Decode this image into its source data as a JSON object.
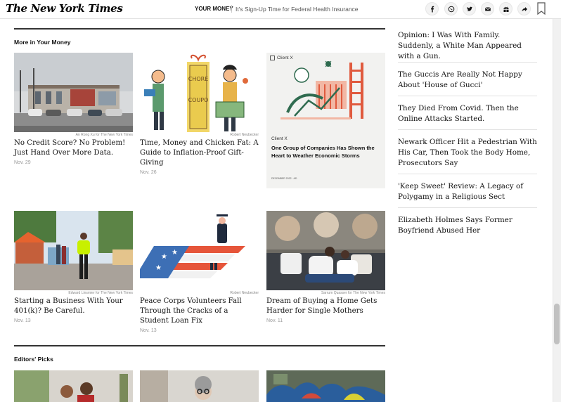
{
  "header": {
    "logo": "The New York Times",
    "section": "YOUR MONEY",
    "headline": "It's Sign-Up Time for Federal Health Insurance",
    "share_icons": [
      "facebook-icon",
      "whatsapp-icon",
      "twitter-icon",
      "email-icon",
      "gift-icon",
      "share-icon"
    ],
    "bookmark_icon": "bookmark-icon"
  },
  "more_section": {
    "title": "More in Your Money",
    "cards": [
      {
        "credit": "An Rong Xu for The New York Times",
        "headline": "No Credit Score? No Problem! Just Hand Over More Data.",
        "date": "Nov. 29"
      },
      {
        "credit": "Robert Neubecker",
        "headline": "Time, Money and Chicken Fat: A Guide to Inflation-Proof Gift-Giving",
        "date": "Nov. 26"
      },
      {
        "credit": "Edward Linsmier for The New York Times",
        "headline": "Starting a Business With Your 401(k)? Be Careful.",
        "date": "Nov. 13"
      },
      {
        "credit": "Robert Neubecker",
        "headline": "Peace Corps Volunteers Fall Through the Cracks of a Student Loan Fix",
        "date": "Nov. 13"
      },
      {
        "credit": "Sarrum Quasser for The New York Times",
        "headline": "Dream of Buying a Home Gets Harder for Single Mothers",
        "date": "Nov. 11"
      }
    ],
    "ad": {
      "label": "Client X",
      "sponsor": "Client X",
      "headline": "One Group of Companies Has Shown the Heart to Weather Economic Storms",
      "meta": "DECEMBER 2022 · AD"
    }
  },
  "editors_picks": {
    "title": "Editors' Picks"
  },
  "rail": {
    "items": [
      "Opinion: I Was With Family. Suddenly, a White Man Appeared with a Gun.",
      "The Guccis Are Really Not Happy About 'House of Gucci'",
      "They Died From Covid. Then the Online Attacks Started.",
      "Newark Officer Hit a Pedestrian With His Car, Then Took the Body Home, Prosecutors Say",
      "'Keep Sweet' Review: A Legacy of Polygamy in a Religious Sect",
      "Elizabeth Holmes Says Former Boyfriend Abused Her"
    ]
  },
  "colors": {
    "rule": "#333333",
    "text": "#121212",
    "muted": "#999999",
    "ad_bg": "#f2f2f0"
  }
}
